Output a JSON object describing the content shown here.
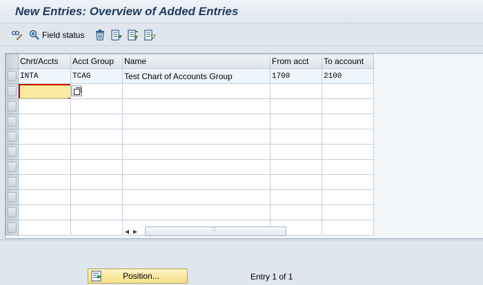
{
  "title": "New Entries: Overview of Added Entries",
  "toolbar": {
    "field_status_label": "Field status",
    "icons": [
      "display-change-icon",
      "field-status-icon",
      "delete-icon",
      "select-all-icon",
      "select-block-icon",
      "deselect-all-icon"
    ]
  },
  "table": {
    "columns": [
      "Chrt/Accts",
      "Acct Group",
      "Name",
      "From acct",
      "To account"
    ],
    "rows": [
      [
        "INTA",
        "TCAG",
        "Test Chart of Accounts Group",
        "1700",
        "2100"
      ],
      [
        "",
        "",
        "",
        "",
        ""
      ],
      [
        "",
        "",
        "",
        "",
        ""
      ],
      [
        "",
        "",
        "",
        "",
        ""
      ],
      [
        "",
        "",
        "",
        "",
        ""
      ],
      [
        "",
        "",
        "",
        "",
        ""
      ],
      [
        "",
        "",
        "",
        "",
        ""
      ],
      [
        "",
        "",
        "",
        "",
        ""
      ],
      [
        "",
        "",
        "",
        "",
        ""
      ],
      [
        "",
        "",
        "",
        "",
        ""
      ],
      [
        "",
        "",
        "",
        "",
        ""
      ]
    ]
  },
  "footer": {
    "position_label": "Position...",
    "entry_info": "Entry 1 of 1"
  },
  "colors": {
    "title": "#1d3a5c",
    "focus_field": "#fbeba0",
    "focus_border": "#d00000",
    "position_button": "#f6df86"
  }
}
